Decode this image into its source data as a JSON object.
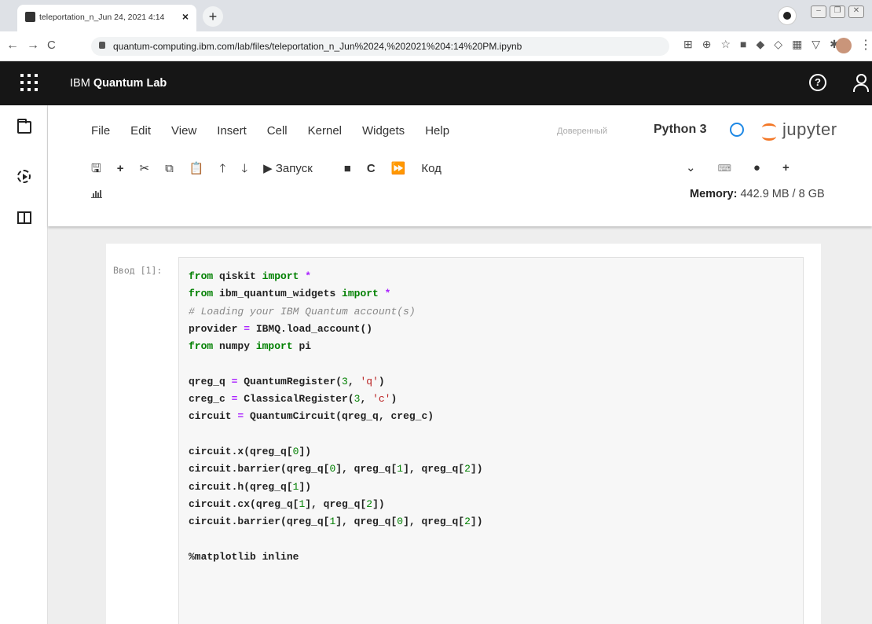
{
  "browser": {
    "tab_title": "teleportation_n_Jun 24, 2021 4:14",
    "url": "quantum-computing.ibm.com/lab/files/teleportation_n_Jun%2024,%202021%204:14%20PM.ipynb"
  },
  "header": {
    "brand_prefix": "IBM",
    "brand_name": "Quantum Lab"
  },
  "menu": [
    "File",
    "Edit",
    "View",
    "Insert",
    "Cell",
    "Kernel",
    "Widgets",
    "Help"
  ],
  "trusted_label": "Доверенный",
  "kernel": {
    "name": "Python 3",
    "logo_text": "jupyter"
  },
  "toolbar": {
    "run_label": "Запуск",
    "cell_type": "Код"
  },
  "memory": {
    "label": "Memory:",
    "value": "442.9 MB / 8 GB"
  },
  "cell": {
    "prompt": "Ввод [1]:",
    "lines": [
      "from qiskit import *",
      "from ibm_quantum_widgets import *",
      "# Loading your IBM Quantum account(s)",
      "provider = IBMQ.load_account()",
      "from numpy import pi",
      "",
      "qreg_q = QuantumRegister(3, 'q')",
      "creg_c = ClassicalRegister(3, 'c')",
      "circuit = QuantumCircuit(qreg_q, creg_c)",
      "",
      "circuit.x(qreg_q[0])",
      "circuit.barrier(qreg_q[0], qreg_q[1], qreg_q[2])",
      "circuit.h(qreg_q[1])",
      "circuit.cx(qreg_q[1], qreg_q[2])",
      "circuit.barrier(qreg_q[1], qreg_q[0], qreg_q[2])",
      "",
      "%matplotlib inline"
    ]
  },
  "colors": {
    "ibm_bar": "#161616",
    "keyword": "#008000",
    "string": "#ba2121",
    "kernel_indicator": "#1e88e5",
    "jupyter_orange": "#f37726"
  }
}
